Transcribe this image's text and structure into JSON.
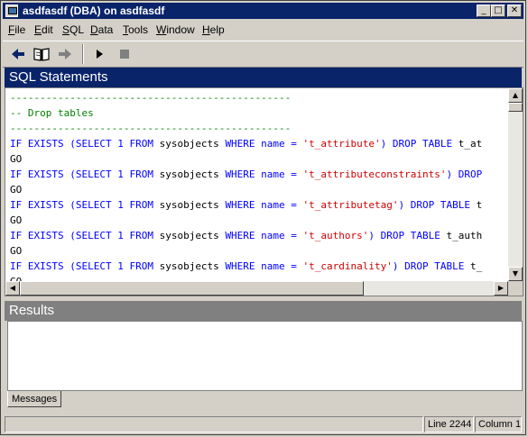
{
  "window": {
    "title": "asdfasdf (DBA) on asdfasdf",
    "minimize_glyph": "_",
    "maximize_glyph": "□",
    "close_glyph": "✕"
  },
  "menu": [
    {
      "label": "File",
      "mnemonic": "F",
      "rest": "ile"
    },
    {
      "label": "Edit",
      "mnemonic": "E",
      "rest": "dit"
    },
    {
      "label": "SQL",
      "mnemonic": "S",
      "rest": "QL"
    },
    {
      "label": "Data",
      "mnemonic": "D",
      "rest": "ata"
    },
    {
      "label": "Tools",
      "mnemonic": "T",
      "rest": "ools"
    },
    {
      "label": "Window",
      "mnemonic": "W",
      "rest": "indow"
    },
    {
      "label": "Help",
      "mnemonic": "H",
      "rest": "elp"
    }
  ],
  "toolbar": {
    "icons": [
      "back-arrow-icon",
      "book-icon",
      "forward-arrow-icon",
      "play-icon",
      "stop-icon"
    ],
    "colors": {
      "back": "#0a246a",
      "forward": "#808080",
      "stop": "#808080"
    }
  },
  "sql_pane": {
    "title": "SQL Statements",
    "lines": [
      [
        {
          "t": "-----------------------------------------------",
          "c": "green"
        }
      ],
      [
        {
          "t": "-- Drop tables",
          "c": "green"
        }
      ],
      [
        {
          "t": "-----------------------------------------------",
          "c": "green"
        }
      ],
      [
        {
          "t": "IF EXISTS (SELECT 1 FROM ",
          "c": "blue"
        },
        {
          "t": "sysobjects ",
          "c": "black"
        },
        {
          "t": "WHERE name = ",
          "c": "blue"
        },
        {
          "t": "'t_attribute'",
          "c": "red"
        },
        {
          "t": ") DROP TABLE ",
          "c": "blue"
        },
        {
          "t": "t_at",
          "c": "black"
        }
      ],
      [
        {
          "t": "GO",
          "c": "black"
        }
      ],
      [
        {
          "t": "IF EXISTS (SELECT 1 FROM ",
          "c": "blue"
        },
        {
          "t": "sysobjects ",
          "c": "black"
        },
        {
          "t": "WHERE name = ",
          "c": "blue"
        },
        {
          "t": "'t_attributeconstraints'",
          "c": "red"
        },
        {
          "t": ") DROP",
          "c": "blue"
        }
      ],
      [
        {
          "t": "GO",
          "c": "black"
        }
      ],
      [
        {
          "t": "IF EXISTS (SELECT 1 FROM ",
          "c": "blue"
        },
        {
          "t": "sysobjects ",
          "c": "black"
        },
        {
          "t": "WHERE name = ",
          "c": "blue"
        },
        {
          "t": "'t_attributetag'",
          "c": "red"
        },
        {
          "t": ") DROP TABLE ",
          "c": "blue"
        },
        {
          "t": "t",
          "c": "black"
        }
      ],
      [
        {
          "t": "GO",
          "c": "black"
        }
      ],
      [
        {
          "t": "IF EXISTS (SELECT 1 FROM ",
          "c": "blue"
        },
        {
          "t": "sysobjects ",
          "c": "black"
        },
        {
          "t": "WHERE name = ",
          "c": "blue"
        },
        {
          "t": "'t_authors'",
          "c": "red"
        },
        {
          "t": ") DROP TABLE ",
          "c": "blue"
        },
        {
          "t": "t_auth",
          "c": "black"
        }
      ],
      [
        {
          "t": "GO",
          "c": "black"
        }
      ],
      [
        {
          "t": "IF EXISTS (SELECT 1 FROM ",
          "c": "blue"
        },
        {
          "t": "sysobjects ",
          "c": "black"
        },
        {
          "t": "WHERE name = ",
          "c": "blue"
        },
        {
          "t": "'t_cardinality'",
          "c": "red"
        },
        {
          "t": ") DROP TABLE ",
          "c": "blue"
        },
        {
          "t": "t_",
          "c": "black"
        }
      ],
      [
        {
          "t": "GO",
          "c": "black"
        }
      ]
    ]
  },
  "results_pane": {
    "title": "Results",
    "tab_label": "Messages"
  },
  "statusbar": {
    "line": "Line 2244",
    "column": "Column 1"
  }
}
